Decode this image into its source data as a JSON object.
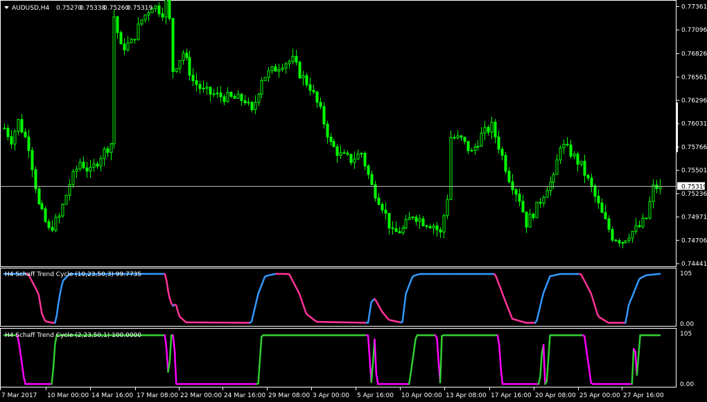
{
  "chart_data": [
    {
      "type": "candlestick",
      "title": "AUDUSD,H4",
      "ohlc_header": [
        "0.75270",
        "0.75338",
        "0.75260",
        "0.75319"
      ],
      "current_price": "0.75319",
      "current_price_value": 0.75319,
      "ylim": [
        0.7441,
        0.7742
      ],
      "y_ticks": [
        "0.77361",
        "0.77096",
        "0.76826",
        "0.76561",
        "0.76296",
        "0.76031",
        "0.75766",
        "0.75501",
        "0.75236",
        "0.74971",
        "0.74706",
        "0.74441"
      ],
      "price_path": [
        [
          0,
          0.7598
        ],
        [
          2,
          0.7585
        ],
        [
          4,
          0.7606
        ],
        [
          7,
          0.7578
        ],
        [
          10,
          0.751
        ],
        [
          13,
          0.7482
        ],
        [
          16,
          0.7497
        ],
        [
          19,
          0.7535
        ],
        [
          22,
          0.756
        ],
        [
          25,
          0.7548
        ],
        [
          28,
          0.7567
        ],
        [
          31,
          0.7581
        ],
        [
          32,
          0.7725
        ],
        [
          34,
          0.7689
        ],
        [
          37,
          0.7695
        ],
        [
          40,
          0.7721
        ],
        [
          43,
          0.7738
        ],
        [
          46,
          0.773
        ],
        [
          47,
          0.7742
        ],
        [
          48,
          0.772
        ],
        [
          49,
          0.7664
        ],
        [
          52,
          0.7684
        ],
        [
          55,
          0.7652
        ],
        [
          58,
          0.764
        ],
        [
          62,
          0.7635
        ],
        [
          66,
          0.7632
        ],
        [
          70,
          0.763
        ],
        [
          72,
          0.7615
        ],
        [
          75,
          0.7655
        ],
        [
          78,
          0.7663
        ],
        [
          81,
          0.7672
        ],
        [
          84,
          0.7675
        ],
        [
          86,
          0.766
        ],
        [
          89,
          0.7645
        ],
        [
          92,
          0.7617
        ],
        [
          95,
          0.758
        ],
        [
          98,
          0.7567
        ],
        [
          101,
          0.7562
        ],
        [
          104,
          0.757
        ],
        [
          107,
          0.7532
        ],
        [
          110,
          0.751
        ],
        [
          113,
          0.7478
        ],
        [
          116,
          0.7483
        ],
        [
          119,
          0.75
        ],
        [
          122,
          0.7492
        ],
        [
          125,
          0.7488
        ],
        [
          127,
          0.7478
        ],
        [
          129,
          0.752
        ],
        [
          130,
          0.7588
        ],
        [
          133,
          0.7585
        ],
        [
          136,
          0.757
        ],
        [
          139,
          0.759
        ],
        [
          142,
          0.76
        ],
        [
          144,
          0.7578
        ],
        [
          147,
          0.7542
        ],
        [
          150,
          0.7518
        ],
        [
          152,
          0.749
        ],
        [
          155,
          0.7508
        ],
        [
          158,
          0.7532
        ],
        [
          160,
          0.754
        ],
        [
          162,
          0.758
        ],
        [
          165,
          0.757
        ],
        [
          168,
          0.7555
        ],
        [
          171,
          0.753
        ],
        [
          174,
          0.75
        ],
        [
          177,
          0.7475
        ],
        [
          180,
          0.747
        ],
        [
          182,
          0.7478
        ],
        [
          185,
          0.7486
        ],
        [
          187,
          0.7496
        ],
        [
          189,
          0.753
        ],
        [
          191,
          0.7532
        ]
      ],
      "x_ticks": [
        "7 Mar 2017",
        "10 Mar 00:00",
        "14 Mar 16:00",
        "17 Mar 08:00",
        "22 Mar 00:00",
        "24 Mar 16:00",
        "29 Mar 08:00",
        "3 Apr 00:00",
        "5 Apr 16:00",
        "10 Apr 00:00",
        "13 Apr 08:00",
        "17 Apr 16:00",
        "20 Apr 08:00",
        "25 Apr 00:00",
        "27 Apr 16:00"
      ],
      "colors": {
        "candle": "#00ff00",
        "background": "#000000",
        "axis": "#ffffff",
        "price_line": "#c0c0c0"
      }
    },
    {
      "type": "line",
      "title": "H4 Schaff Trend Cycle (10,23,50,3) 99.7735",
      "ylim": [
        0,
        105
      ],
      "y_ticks": [
        "105",
        "0.00"
      ],
      "series": [
        {
          "values_at_bar": [
            [
              0,
              99.7
            ],
            [
              7,
              99.7
            ],
            [
              10,
              60
            ],
            [
              11,
              20
            ],
            [
              12,
              5
            ],
            [
              14,
              2
            ],
            [
              15,
              2
            ],
            [
              16,
              50
            ],
            [
              17,
              85
            ],
            [
              19,
              99.5
            ],
            [
              47,
              99.7
            ],
            [
              48,
              55
            ],
            [
              49,
              35
            ],
            [
              50,
              40
            ],
            [
              51,
              15
            ],
            [
              53,
              3
            ],
            [
              72,
              2
            ],
            [
              74,
              60
            ],
            [
              76,
              95
            ],
            [
              79,
              99.7
            ],
            [
              83,
              99.5
            ],
            [
              86,
              60
            ],
            [
              88,
              20
            ],
            [
              91,
              4
            ],
            [
              106,
              2
            ],
            [
              107,
              45
            ],
            [
              108,
              50
            ],
            [
              110,
              25
            ],
            [
              112,
              8
            ],
            [
              116,
              2
            ],
            [
              117,
              60
            ],
            [
              119,
              95
            ],
            [
              121,
              99.5
            ],
            [
              143,
              99.5
            ],
            [
              146,
              45
            ],
            [
              148,
              10
            ],
            [
              152,
              2
            ],
            [
              155,
              2
            ],
            [
              157,
              60
            ],
            [
              159,
              95
            ],
            [
              162,
              99.5
            ],
            [
              168,
              99.5
            ],
            [
              171,
              60
            ],
            [
              173,
              15
            ],
            [
              176,
              2
            ],
            [
              181,
              2
            ],
            [
              182,
              40
            ],
            [
              183,
              55
            ],
            [
              185,
              90
            ],
            [
              187,
              97
            ],
            [
              191,
              99.8
            ]
          ]
        }
      ],
      "colors": {
        "rising": "#3399ff",
        "falling": "#ff3399"
      }
    },
    {
      "type": "line",
      "title": "H4 Schaff Trend Cycle (2,23,50,1) 100.0000",
      "ylim": [
        0,
        105
      ],
      "y_ticks": [
        "105",
        "0.00"
      ],
      "series": [
        {
          "values_at_bar": [
            [
              0,
              100
            ],
            [
              4,
              100
            ],
            [
              6,
              0
            ],
            [
              14,
              0
            ],
            [
              15,
              100
            ],
            [
              47,
              100
            ],
            [
              48,
              0
            ],
            [
              48.5,
              100
            ],
            [
              49.5,
              100
            ],
            [
              50,
              0
            ],
            [
              74,
              0
            ],
            [
              75,
              100
            ],
            [
              106,
              100
            ],
            [
              107,
              0
            ],
            [
              108,
              100
            ],
            [
              108.5,
              0
            ],
            [
              118,
              0
            ],
            [
              120,
              100
            ],
            [
              126,
              100
            ],
            [
              127,
              0
            ],
            [
              127.5,
              100
            ],
            [
              144,
              100
            ],
            [
              145,
              0
            ],
            [
              156,
              0
            ],
            [
              157,
              100
            ],
            [
              157.5,
              0
            ],
            [
              158,
              0
            ],
            [
              159,
              100
            ],
            [
              169,
              100
            ],
            [
              171,
              0
            ],
            [
              183,
              0
            ],
            [
              183.5,
              100
            ],
            [
              184.5,
              0
            ],
            [
              185,
              100
            ],
            [
              191,
              100
            ]
          ]
        }
      ],
      "colors": {
        "rising": "#33cc33",
        "falling": "#ff00ff"
      }
    }
  ]
}
